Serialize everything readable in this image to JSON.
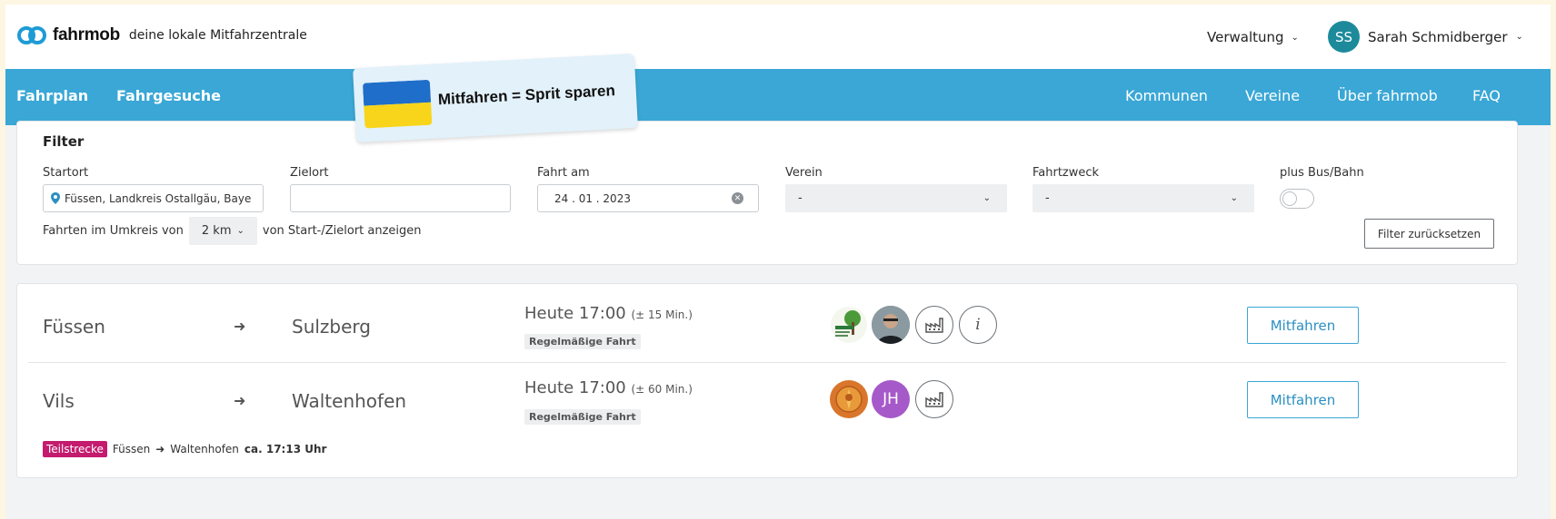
{
  "header": {
    "logo_text": "fahrmob",
    "tagline": "deine lokale Mitfahrzentrale",
    "admin_menu": "Verwaltung",
    "user_initials": "SS",
    "user_name": "Sarah Schmidberger"
  },
  "nav": {
    "left": [
      "Fahrplan",
      "Fahrgesuche"
    ],
    "right": [
      "Kommunen",
      "Vereine",
      "Über fahrmob",
      "FAQ"
    ]
  },
  "banner": {
    "text": "Mitfahren = Sprit sparen"
  },
  "filter": {
    "title": "Filter",
    "start_label": "Startort",
    "start_value": "Füssen, Landkreis Ostallgäu, Baye",
    "destination_label": "Zielort",
    "destination_value": "",
    "date_label": "Fahrt am",
    "date_value": "24 . 01 . 2023",
    "club_label": "Verein",
    "club_value": "-",
    "purpose_label": "Fahrtzweck",
    "purpose_value": "-",
    "transit_label": "plus Bus/Bahn",
    "transit_on": false,
    "radius_prefix": "Fahrten im Umkreis von",
    "radius_value": "2 km",
    "radius_suffix": "von Start-/Zielort anzeigen",
    "reset_label": "Filter zurücksetzen"
  },
  "rides": [
    {
      "from": "Füssen",
      "to": "Sulzberg",
      "time": "Heute 17:00",
      "tolerance": "(± 15 Min.)",
      "tag": "Regelmäßige Fahrt",
      "button": "Mitfahren"
    },
    {
      "from": "Vils",
      "to": "Waltenhofen",
      "time": "Heute 17:00",
      "tolerance": "(± 60 Min.)",
      "tag": "Regelmäßige Fahrt",
      "avatar_initials": "JH",
      "button": "Mitfahren",
      "partial": {
        "badge": "Teilstrecke",
        "from": "Füssen",
        "to": "Waltenhofen",
        "eta": "ca. 17:13 Uhr"
      }
    }
  ],
  "colors": {
    "nav_blue": "#3aa7d6",
    "user_avatar": "#1d8a9b",
    "jh_avatar": "#a659c9",
    "partial_badge": "#c41b6e"
  }
}
